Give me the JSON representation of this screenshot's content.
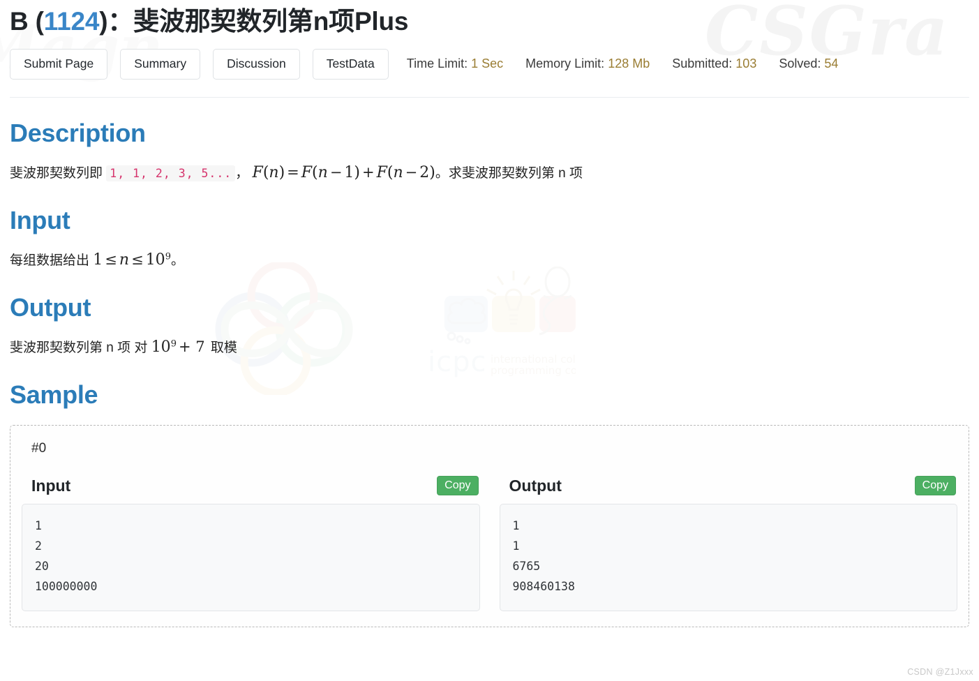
{
  "header": {
    "title_prefix": "B (",
    "problem_id": "1124",
    "title_suffix": ")：斐波那契数列第n项Plus",
    "buttons": [
      {
        "label": "Submit Page"
      },
      {
        "label": "Summary"
      },
      {
        "label": "Discussion"
      },
      {
        "label": "TestData"
      }
    ],
    "meta": [
      {
        "label": "Time Limit:",
        "value": "1 Sec"
      },
      {
        "label": "Memory Limit:",
        "value": "128 Mb"
      },
      {
        "label": "Submitted:",
        "value": "103"
      },
      {
        "label": "Solved:",
        "value": "54"
      }
    ]
  },
  "sections": {
    "description": {
      "heading": "Description",
      "text_before_code": "斐波那契数列即",
      "inline_code": "1, 1, 2, 3, 5...",
      "comma": "，",
      "formula": "F(n) = F(n − 1) + F(n − 2)",
      "formula_f": "F",
      "formula_n": "n",
      "text_after": "。求斐波那契数列第 n 项"
    },
    "input": {
      "heading": "Input",
      "text_before": "每组数据给出",
      "range_lo": "1",
      "le1": "≤",
      "var": "n",
      "le2": "≤",
      "range_hi_base": "10",
      "range_hi_exp": "9",
      "text_after": "。"
    },
    "output": {
      "heading": "Output",
      "text_before": "斐波那契数列第 n 项 对",
      "mod_base": "10",
      "mod_exp": "9",
      "mod_plus": "+ 7",
      "text_after": "取模"
    },
    "sample": {
      "heading": "Sample",
      "case_id": "#0",
      "input_title": "Input",
      "output_title": "Output",
      "copy_label": "Copy",
      "input_text": "1\n2\n20\n100000000",
      "output_text": "1\n1\n6765\n908460138"
    }
  },
  "footer": {
    "watermark": "CSDN @Z1Jxxx"
  },
  "colors": {
    "heading_blue": "#2b7cb8",
    "pid_blue": "#3a86c8",
    "meta_value": "#9a7d33",
    "inline_code": "#d6336c",
    "copy_green": "#4caf62"
  }
}
